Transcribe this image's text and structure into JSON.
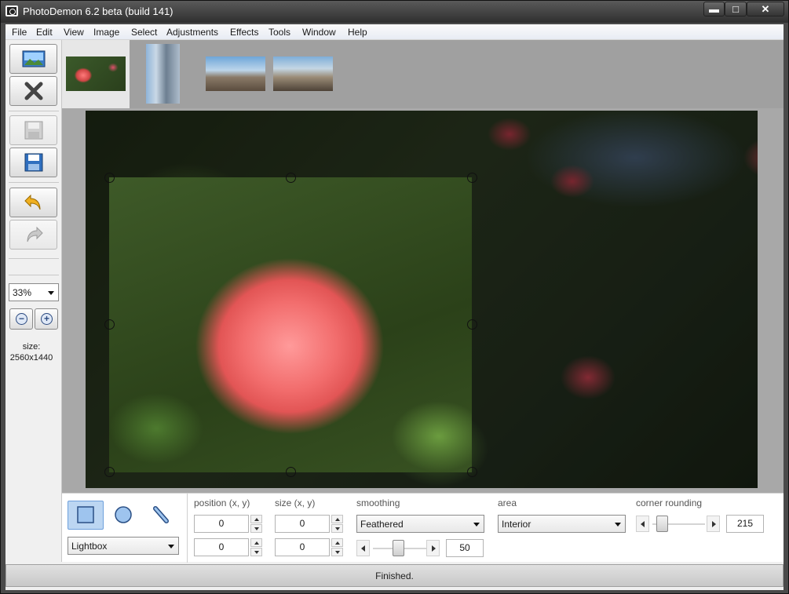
{
  "window": {
    "title": "PhotoDemon 6.2 beta (build 141)",
    "controls": {
      "minimize": "▬",
      "maximize": "□",
      "close": "✕"
    }
  },
  "menu": [
    "File",
    "Edit",
    "View",
    "Image",
    "Select",
    "Adjustments",
    "Effects",
    "Tools",
    "Window",
    "Help"
  ],
  "left_toolbar": {
    "buttons": [
      {
        "name": "open-image",
        "icon": "image-icon",
        "enabled": true
      },
      {
        "name": "close-image",
        "icon": "close-x-icon",
        "enabled": true
      },
      {
        "name": "save",
        "icon": "floppy-icon",
        "enabled": false
      },
      {
        "name": "save-as",
        "icon": "floppy-icon",
        "enabled": true
      },
      {
        "name": "undo",
        "icon": "undo-arrow-icon",
        "enabled": true
      },
      {
        "name": "redo",
        "icon": "redo-arrow-icon",
        "enabled": false
      }
    ],
    "zoom": "33%",
    "zoom_out": "−",
    "zoom_in": "+",
    "size_label": "size:",
    "size_value": "2560x1440"
  },
  "thumbnails": [
    {
      "name": "rose",
      "active": true
    },
    {
      "name": "tower",
      "active": false
    },
    {
      "name": "arch-street",
      "active": false
    },
    {
      "name": "street-crowd",
      "active": false
    }
  ],
  "options": {
    "selection_style": "Lightbox",
    "position_label": "position (x, y)",
    "position_x": "0",
    "position_y": "0",
    "size_label": "size (x, y)",
    "size_x": "0",
    "size_y": "0",
    "smoothing_label": "smoothing",
    "smoothing_value": "Feathered",
    "smoothing_amount": "50",
    "area_label": "area",
    "area_value": "Interior",
    "corner_label": "corner rounding",
    "corner_value": "215"
  },
  "status": "Finished.",
  "colors": {
    "titlebar": "#3a3a3a",
    "canvas_bg": "#a8a8a8",
    "thumb_bar": "#a0a0a0",
    "active_tool": "#bcd6f2"
  }
}
